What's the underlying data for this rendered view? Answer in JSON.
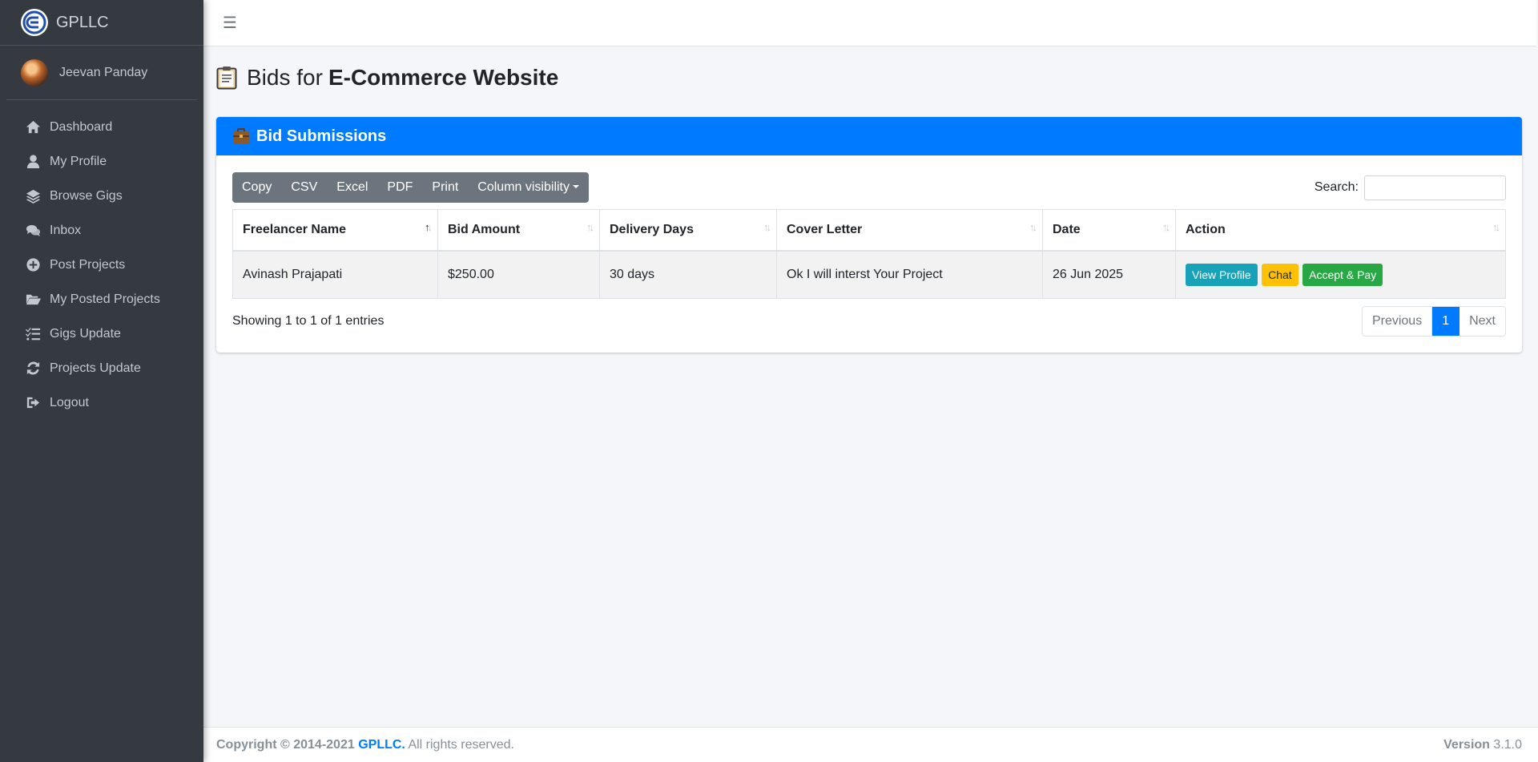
{
  "brand": {
    "name": "GPLLC"
  },
  "user": {
    "name": "Jeevan Panday"
  },
  "sidebar": {
    "items": [
      {
        "label": "Dashboard",
        "icon": "home-icon"
      },
      {
        "label": "My Profile",
        "icon": "user-icon"
      },
      {
        "label": "Browse Gigs",
        "icon": "layers-icon"
      },
      {
        "label": "Inbox",
        "icon": "comments-icon"
      },
      {
        "label": "Post Projects",
        "icon": "plus-circle-icon"
      },
      {
        "label": "My Posted Projects",
        "icon": "folder-open-icon"
      },
      {
        "label": "Gigs Update",
        "icon": "tasks-icon"
      },
      {
        "label": "Projects Update",
        "icon": "sync-icon"
      },
      {
        "label": "Logout",
        "icon": "sign-out-icon"
      }
    ]
  },
  "page": {
    "title_prefix": "Bids for",
    "title_project": "E-Commerce Website"
  },
  "card": {
    "title": "Bid Submissions"
  },
  "toolbar": {
    "buttons": [
      "Copy",
      "CSV",
      "Excel",
      "PDF",
      "Print"
    ],
    "column_visibility": "Column visibility",
    "search_label": "Search:",
    "search_value": ""
  },
  "table": {
    "headers": [
      "Freelancer Name",
      "Bid Amount",
      "Delivery Days",
      "Cover Letter",
      "Date",
      "Action"
    ],
    "rows": [
      {
        "freelancer": "Avinash Prajapati",
        "amount": "$250.00",
        "days": "30 days",
        "cover": "Ok I will interst Your Project",
        "date": "26 Jun 2025",
        "actions": [
          "View Profile",
          "Chat",
          "Accept & Pay"
        ]
      }
    ]
  },
  "info": "Showing 1 to 1 of 1 entries",
  "pagination": {
    "previous": "Previous",
    "current": "1",
    "next": "Next"
  },
  "footer": {
    "copyright": "Copyright © 2014-2021",
    "brand": "GPLLC.",
    "rights": "All rights reserved.",
    "version_label": "Version",
    "version": "3.1.0"
  },
  "colors": {
    "primary": "#007bff",
    "sidebar": "#343a40",
    "info": "#17a2b8",
    "warning": "#ffc107",
    "success": "#28a745"
  }
}
